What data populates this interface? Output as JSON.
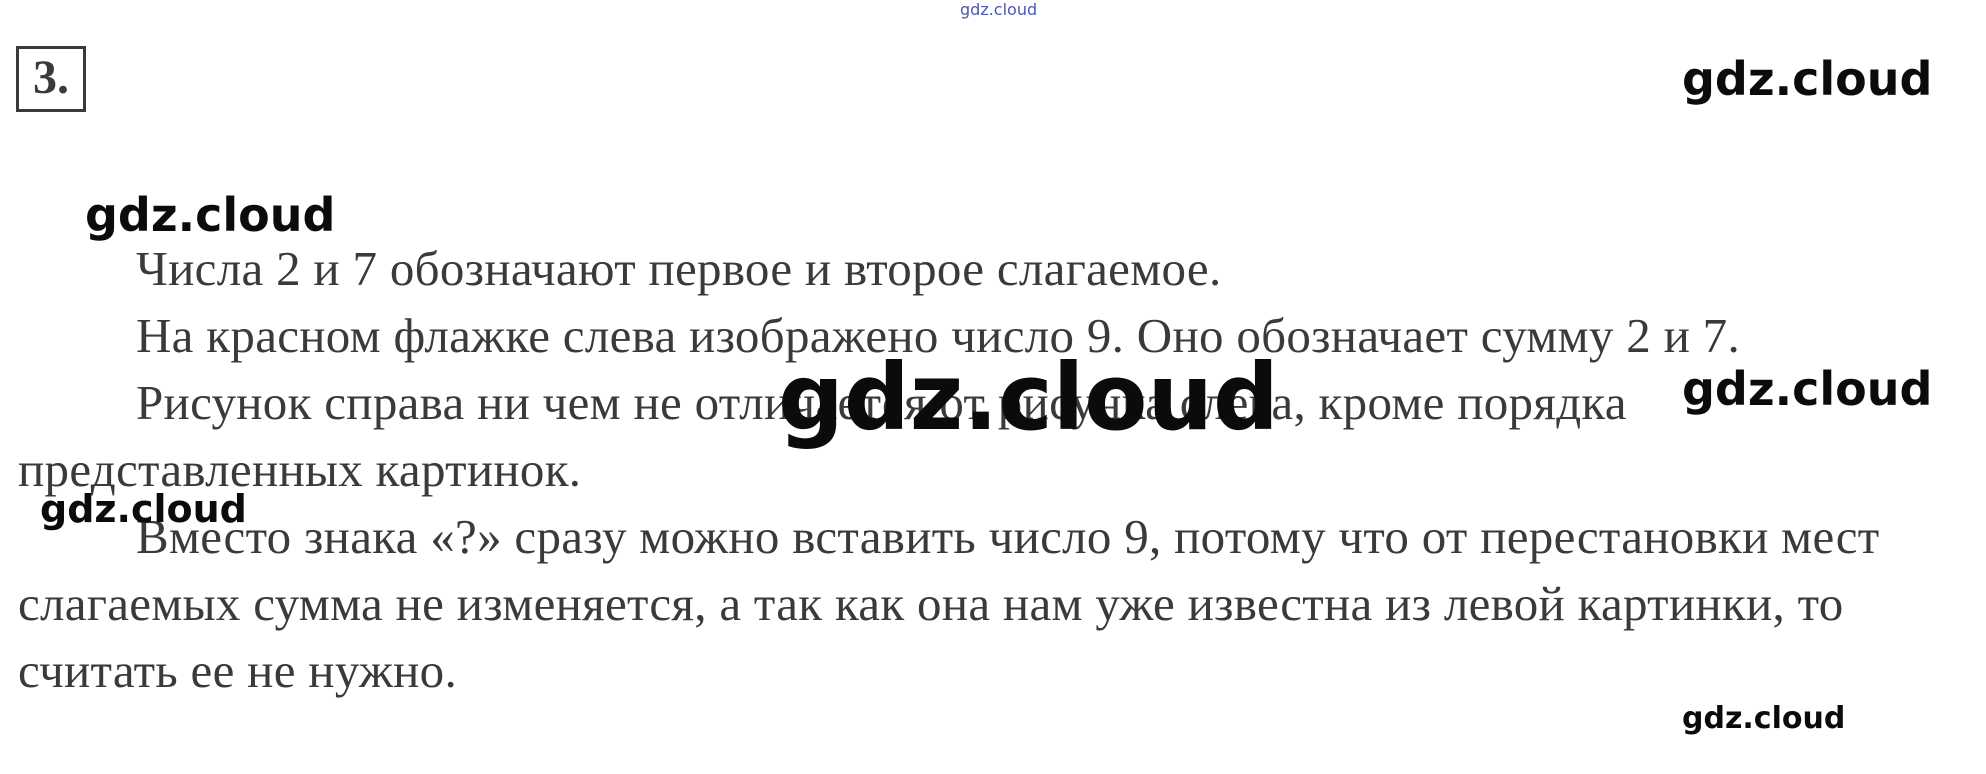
{
  "task_number": "3.",
  "watermark": "gdz.cloud",
  "paragraphs": [
    "Числа 2 и 7 обозначают первое и второе слагаемое.",
    "На красном флажке слева изображено число 9. Оно обозначает сумму 2 и 7.",
    "Рисунок справа ни чем не отличается от рисунка слева, кроме порядка представленных картинок.",
    "Вместо знака «?» сразу можно вставить число 9, потому что от перестановки мест слагаемых сумма не изменяется, а так как она нам уже известна из левой картинки, то считать ее не нужно."
  ]
}
